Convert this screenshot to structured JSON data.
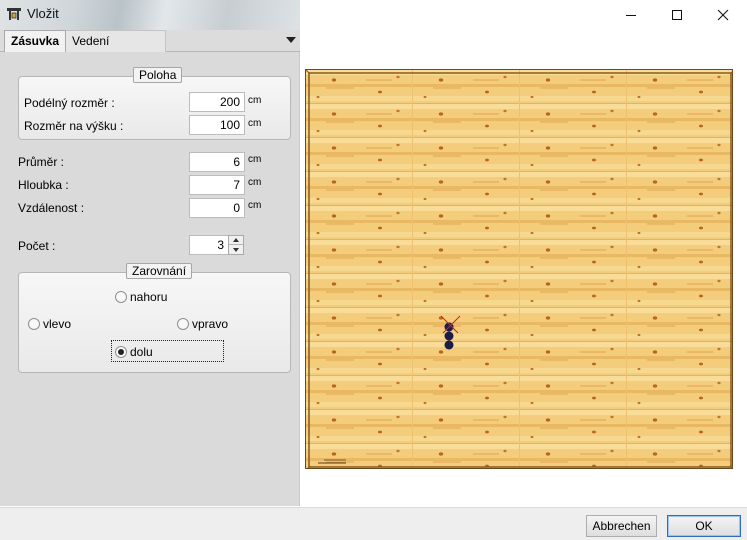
{
  "window": {
    "title": "Vložit"
  },
  "tabs": [
    {
      "label": "Zásuvka",
      "active": true
    },
    {
      "label": "Vedení",
      "active": false
    }
  ],
  "poloha": {
    "title": "Poloha",
    "fields": [
      {
        "label": "Podélný rozměr :",
        "value": "200",
        "unit": "cm"
      },
      {
        "label": "Rozměr na výšku :",
        "value": "100",
        "unit": "cm"
      }
    ]
  },
  "fields": [
    {
      "label": "Průměr :",
      "value": "6",
      "unit": "cm"
    },
    {
      "label": "Hloubka :",
      "value": "7",
      "unit": "cm"
    },
    {
      "label": "Vzdálenost :",
      "value": "0",
      "unit": "cm"
    }
  ],
  "pocet": {
    "label": "Počet :",
    "value": "3"
  },
  "zarovnani": {
    "title": "Zarovnání",
    "options": {
      "nahoru": "nahoru",
      "vlevo": "vlevo",
      "vpravo": "vpravo",
      "dolu": "dolu"
    },
    "selected": "dolu"
  },
  "buttons": {
    "cancel": "Abbrechen",
    "ok": "OK"
  },
  "colors": {
    "wood_light": "#f5cf7e",
    "wood_dark": "#d9a046",
    "frame": "#8a5a1c",
    "marker": "#1c1c4a",
    "marker_cross": "#c0282b"
  }
}
